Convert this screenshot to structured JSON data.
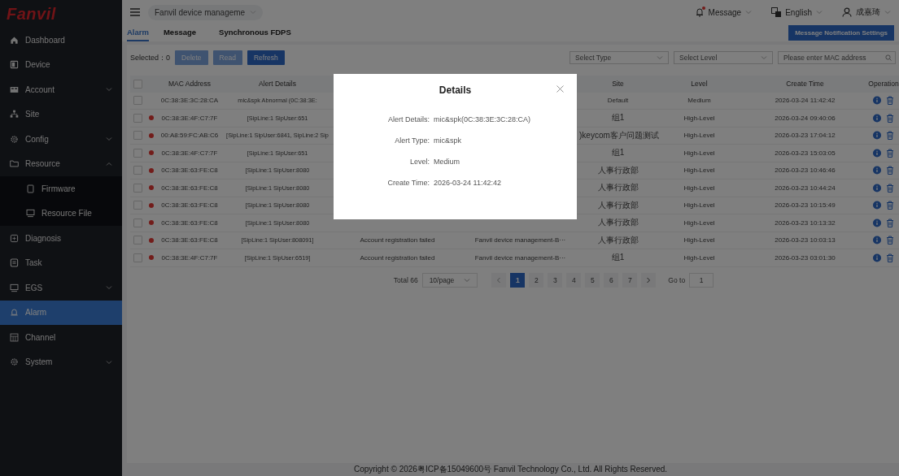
{
  "logo": "Fanvil",
  "sidebar": {
    "items": [
      {
        "label": "Dashboard",
        "selected": false
      },
      {
        "label": "Device",
        "selected": false
      },
      {
        "label": "Account",
        "selected": false,
        "expanded": false
      },
      {
        "label": "Site",
        "selected": false
      },
      {
        "label": "Config",
        "selected": false,
        "expanded": false
      },
      {
        "label": "Resource",
        "selected": false,
        "expanded": true,
        "children": [
          {
            "label": "Firmware",
            "selected": false
          },
          {
            "label": "Resource File",
            "selected": false
          }
        ]
      },
      {
        "label": "Diagnosis",
        "selected": false
      },
      {
        "label": "Task",
        "selected": false
      },
      {
        "label": "EGS",
        "selected": false,
        "expanded": false
      },
      {
        "label": "Alarm",
        "selected": true
      },
      {
        "label": "Channel",
        "selected": false
      },
      {
        "label": "System",
        "selected": false,
        "expanded": false
      }
    ]
  },
  "header": {
    "project": "Fanvil device manageme",
    "message": "Message",
    "message_unread": true,
    "language": "English",
    "user": "成嘉琦"
  },
  "tabs": [
    {
      "label": "Alarm",
      "selected": true
    },
    {
      "label": "Message",
      "selected": false
    },
    {
      "label": "Synchronous FDPS",
      "selected": false
    }
  ],
  "settings_button": "Message Notification Settings",
  "toolbar": {
    "selected_label": "Selected：0",
    "buttons": [
      {
        "label": "Delete",
        "disabled": true
      },
      {
        "label": "Read",
        "disabled": true
      },
      {
        "label": "Refresh",
        "disabled": false
      }
    ],
    "type_select": {
      "placeholder": "Select Type"
    },
    "level_select": {
      "placeholder": "Select Level"
    },
    "mac_search": {
      "placeholder": "Please enter MAC address"
    }
  },
  "table": {
    "all_checked": false,
    "columns": [
      "MAC Address",
      "Alert Details",
      "Site",
      "Level",
      "Create Time",
      "Operation"
    ],
    "rows": [
      {
        "checked": false,
        "unread": false,
        "mac": "0C:38:3E:3C:28:CA",
        "details": "mic&spk Abnormal (0C:38:3E:",
        "site": "Default",
        "level": "Medium",
        "time": "2026-03-24 11:42:42"
      },
      {
        "checked": false,
        "unread": true,
        "mac": "0C:38:3E:4F:C7:7F",
        "details": "[SipLine:1 SipUser:651",
        "site": "组1",
        "level": "High-Level",
        "time": "2026-03-24 09:40:06"
      },
      {
        "checked": false,
        "unread": true,
        "mac": "00:A8:59:FC:AB:C6",
        "details": "[SipLine:1 SipUser:6841, SipLine:2 Sip",
        "site": ")keycom客户问题测试",
        "level": "High-Level",
        "time": "2026-03-23 17:04:12"
      },
      {
        "checked": false,
        "unread": true,
        "mac": "0C:38:3E:4F:C7:7F",
        "details": "[SipLine:1 SipUser:651",
        "site": "组1",
        "level": "High-Level",
        "time": "2026-03-23 15:03:05"
      },
      {
        "checked": false,
        "unread": true,
        "mac": "0C:38:3E:63:FE:C8",
        "details": "[SipLine:1 SipUser:8080",
        "site": "人事行政部",
        "level": "High-Level",
        "time": "2026-03-23 10:46:46"
      },
      {
        "checked": false,
        "unread": true,
        "mac": "0C:38:3E:63:FE:C8",
        "details": "[SipLine:1 SipUser:8080",
        "site": "人事行政部",
        "level": "High-Level",
        "time": "2026-03-23 10:44:24"
      },
      {
        "checked": false,
        "unread": true,
        "mac": "0C:38:3E:63:FE:C8",
        "details": "[SipLine:1 SipUser:8080",
        "site": "人事行政部",
        "level": "High-Level",
        "time": "2026-03-23 10:15:49"
      },
      {
        "checked": false,
        "unread": true,
        "mac": "0C:38:3E:63:FE:C8",
        "details": "[SipLine:1 SipUser:8080",
        "site": "人事行政部",
        "level": "High-Level",
        "time": "2026-03-23 10:13:32"
      },
      {
        "checked": false,
        "unread": true,
        "mac": "0C:38:3E:63:FE:C8",
        "details": "[SipLine:1 SipUser:808091]",
        "alert_type": "Account registration failed",
        "belongs_to": "Fanvil device management-B···",
        "site": "人事行政部",
        "level": "High-Level",
        "time": "2026-03-23 10:03:13"
      },
      {
        "checked": false,
        "unread": true,
        "mac": "0C:38:3E:4F:C7:7F",
        "details": "[SipLine:1 SipUser:6519]",
        "alert_type": "Account registration failed",
        "belongs_to": "Fanvil device management-B···",
        "site": "组1",
        "level": "High-Level",
        "time": "2026-03-23 03:01:30"
      }
    ]
  },
  "pagination": {
    "total": "Total 66",
    "page_size": "10/page",
    "pages": [
      {
        "label": "1",
        "selected": true
      },
      {
        "label": "2",
        "selected": false
      },
      {
        "label": "3",
        "selected": false
      },
      {
        "label": "4",
        "selected": false
      },
      {
        "label": "5",
        "selected": false
      },
      {
        "label": "6",
        "selected": false
      },
      {
        "label": "7",
        "selected": false
      }
    ],
    "goto_label": "Go to",
    "goto_value": "1"
  },
  "footer": "Copyright © 2026粤ICP备15049600号 Fanvil Technology Co., Ltd. All Rights Reserved.",
  "dialog": {
    "title": "Details",
    "fields": [
      {
        "label": "Alert Details:",
        "value": "mic&spk(0C:38:3E:3C:28:CA)"
      },
      {
        "label": "Alert Type:",
        "value": "mic&spk"
      },
      {
        "label": "Level:",
        "value": "Medium"
      },
      {
        "label": "Create Time:",
        "value": "2026-03-24 11:42:42"
      }
    ]
  }
}
